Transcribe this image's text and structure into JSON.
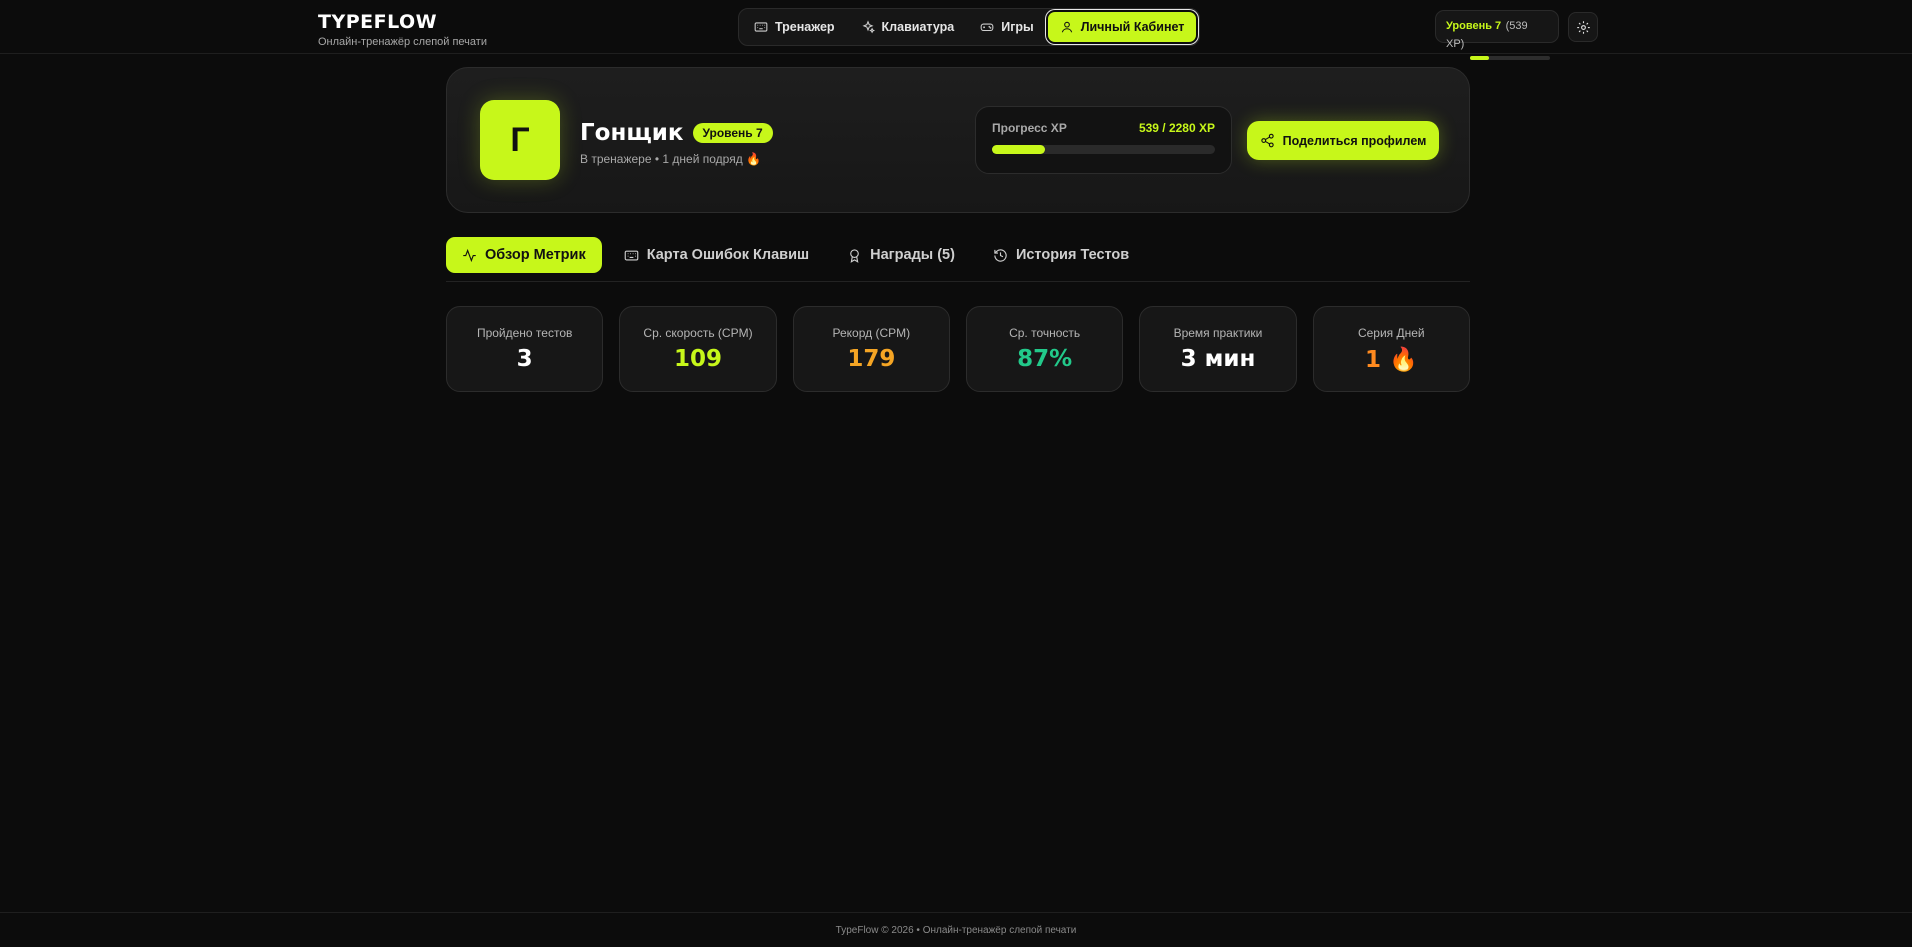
{
  "brand": {
    "title": "TYPEFLOW",
    "subtitle": "Онлайн-тренажёр слепой печати"
  },
  "nav": {
    "items": [
      {
        "label": "Тренажер",
        "icon": "keyboard-icon",
        "active": false
      },
      {
        "label": "Клавиатура",
        "icon": "sparkles-icon",
        "active": false
      },
      {
        "label": "Игры",
        "icon": "gamepad-icon",
        "active": false
      },
      {
        "label": "Личный Кабинет",
        "icon": "user-icon",
        "active": true
      }
    ]
  },
  "header_level": {
    "level_label": "Уровень 7",
    "xp_label": "(539 XP)",
    "progress": 0.24
  },
  "settings": {
    "icon": "gear-icon"
  },
  "profile": {
    "avatar_letter": "Г",
    "name": "Гонщик",
    "level_badge": "Уровень 7",
    "subtitle": "В тренажере • 1 дней подряд",
    "fire_icon": "🔥",
    "xp": {
      "label": "Прогресс XP",
      "value": "539 / 2280 XP",
      "current": 539,
      "max": 2280
    },
    "share_label": "Поделиться профилем"
  },
  "tabs": [
    {
      "label": "Обзор Метрик",
      "icon": "activity-icon",
      "active": true
    },
    {
      "label": "Карта Ошибок Клавиш",
      "icon": "keyboard-icon",
      "active": false
    },
    {
      "label": "Награды (5)",
      "icon": "award-icon",
      "active": false
    },
    {
      "label": "История Тестов",
      "icon": "history-icon",
      "active": false
    }
  ],
  "metrics": [
    {
      "label": "Пройдено тестов",
      "value": "3",
      "color": "#ffffff"
    },
    {
      "label": "Ср. скорость (CPM)",
      "value": "109",
      "color": "#c7f71a"
    },
    {
      "label": "Рекорд (CPM)",
      "value": "179",
      "color": "#f5a524"
    },
    {
      "label": "Ср. точность",
      "value": "87%",
      "color": "#22c98a"
    },
    {
      "label": "Время практики",
      "value": "3 мин",
      "color": "#ffffff"
    },
    {
      "label": "Серия Дней",
      "value": "1 🔥",
      "color": "#ff8a1f"
    }
  ],
  "footer": {
    "text": "TypeFlow © 2026 • Онлайн-тренажёр слепой печати"
  },
  "colors": {
    "accent": "#c7f71a",
    "background": "#0c0c0c",
    "card": "#171717"
  }
}
